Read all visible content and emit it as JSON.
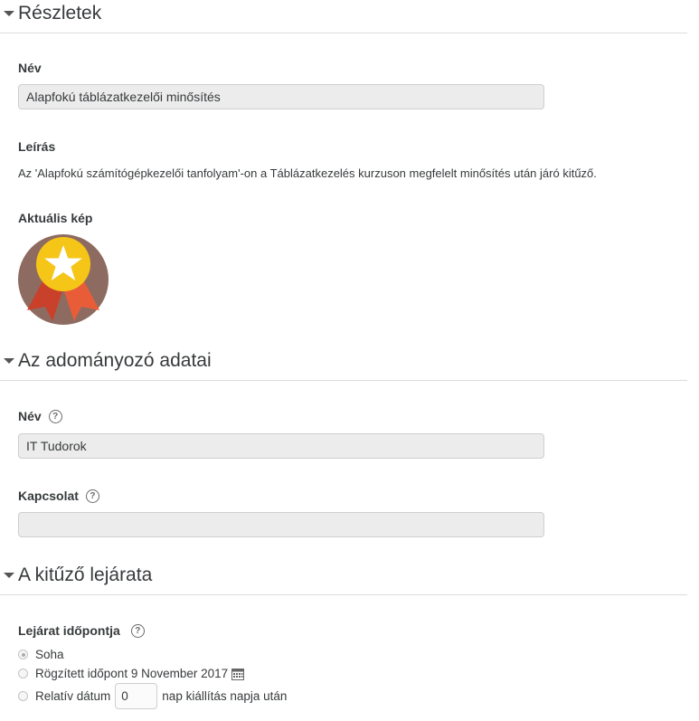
{
  "sections": {
    "details": {
      "title": "Részletek",
      "name_label": "Név",
      "name_value": "Alapfokú táblázatkezelői minősítés",
      "description_label": "Leírás",
      "description_text": "Az 'Alapfokú számítógépkezelői tanfolyam'-on a Táblázatkezelés kurzuson megfelelt minősítés után járó kitűző.",
      "image_label": "Aktuális kép"
    },
    "issuer": {
      "title": "Az adományozó adatai",
      "name_label": "Név",
      "name_value": "IT Tudorok",
      "contact_label": "Kapcsolat",
      "contact_value": ""
    },
    "expiry": {
      "title": "A kitűző lejárata",
      "date_label": "Lejárat időpontja",
      "option_never": "Soha",
      "option_fixed": "Rögzített időpont 9 November 2017",
      "option_relative_prefix": "Relatív dátum",
      "relative_value": "0",
      "option_relative_suffix": "nap kiállítás napja után",
      "selected": "never"
    }
  },
  "icons": {
    "collapse": "chevron-down-icon",
    "help": "help-icon",
    "calendar": "calendar-icon",
    "badge": "star-medal-badge"
  },
  "colors": {
    "badge_background": "#8e6b61",
    "badge_medal": "#f5c518",
    "badge_ribbon": "#e24e2e"
  }
}
